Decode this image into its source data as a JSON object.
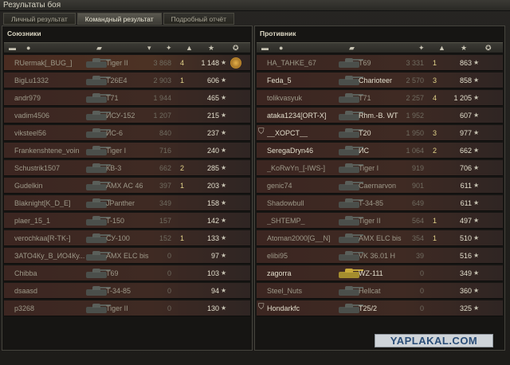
{
  "window": {
    "title": "Результаты боя"
  },
  "tabs": [
    {
      "label": "Личный результат"
    },
    {
      "label": "Командный результат"
    },
    {
      "label": "Подробный отчёт"
    }
  ],
  "allies": {
    "title": "Союзники",
    "rows": [
      {
        "name": "RUermak[_BUG_]",
        "tank": "Tiger II",
        "damage": "3 868",
        "kills": "4",
        "xp": "1 148",
        "alive": false,
        "self": true,
        "medal": true
      },
      {
        "name": "BigLu1332",
        "tank": "T26E4",
        "damage": "2 903",
        "kills": "1",
        "xp": "606",
        "alive": false
      },
      {
        "name": "andr979",
        "tank": "T71",
        "damage": "1 944",
        "kills": "",
        "xp": "465",
        "alive": false
      },
      {
        "name": "vadim4506",
        "tank": "ИСУ-152",
        "damage": "1 207",
        "kills": "",
        "xp": "215",
        "alive": false
      },
      {
        "name": "viksteel56",
        "tank": "ИС-6",
        "damage": "840",
        "kills": "",
        "xp": "237",
        "alive": false
      },
      {
        "name": "Frankenshtene_voin",
        "tank": "Tiger I",
        "damage": "716",
        "kills": "",
        "xp": "240",
        "alive": false
      },
      {
        "name": "Schustrik1507",
        "tank": "КВ-3",
        "damage": "662",
        "kills": "2",
        "xp": "285",
        "alive": false
      },
      {
        "name": "Gudelkin",
        "tank": "AMX AC 46",
        "damage": "397",
        "kills": "1",
        "xp": "203",
        "alive": false
      },
      {
        "name": "Blaknight[K_D_E]",
        "tank": "JPanther",
        "damage": "349",
        "kills": "",
        "xp": "158",
        "alive": false
      },
      {
        "name": "plaer_15_1",
        "tank": "T-150",
        "damage": "157",
        "kills": "",
        "xp": "142",
        "alive": false
      },
      {
        "name": "verochkaa[R-TK-]",
        "tank": "СУ-100",
        "damage": "152",
        "kills": "1",
        "xp": "133",
        "alive": false
      },
      {
        "name": "ЗАТО4Ку_В_ИО4Ку...",
        "tank": "AMX ELC bis",
        "damage": "0",
        "kills": "",
        "xp": "97",
        "alive": false
      },
      {
        "name": "Chibba",
        "tank": "T69",
        "damage": "0",
        "kills": "",
        "xp": "103",
        "alive": false
      },
      {
        "name": "dsaasd",
        "tank": "T-34-85",
        "damage": "0",
        "kills": "",
        "xp": "94",
        "alive": false
      },
      {
        "name": "p3268",
        "tank": "Tiger II",
        "damage": "0",
        "kills": "",
        "xp": "130",
        "alive": false
      }
    ]
  },
  "enemies": {
    "title": "Противник",
    "rows": [
      {
        "name": "HA_TAHKE_67",
        "tank": "T69",
        "damage": "3 331",
        "kills": "1",
        "xp": "863",
        "alive": false
      },
      {
        "name": "Feda_5",
        "tank": "Charioteer",
        "damage": "2 570",
        "kills": "3",
        "xp": "858",
        "alive": true
      },
      {
        "name": "tolikvasyuk",
        "tank": "T71",
        "damage": "2 257",
        "kills": "4",
        "xp": "1 205",
        "alive": false
      },
      {
        "name": "ataka1234[ORT-X]",
        "tank": "Rhm.-B. WT",
        "damage": "1 952",
        "kills": "",
        "xp": "607",
        "alive": true
      },
      {
        "name": "__XOPCT__",
        "tank": "T20",
        "damage": "1 950",
        "kills": "3",
        "xp": "977",
        "alive": true,
        "ribbon": true
      },
      {
        "name": "SeregaDryn46",
        "tank": "ИС",
        "damage": "1 064",
        "kills": "2",
        "xp": "662",
        "alive": true
      },
      {
        "name": "_KoRwYn_[-IWS-]",
        "tank": "Tiger I",
        "damage": "919",
        "kills": "",
        "xp": "706",
        "alive": false
      },
      {
        "name": "genic74",
        "tank": "Caernarvon",
        "damage": "901",
        "kills": "",
        "xp": "611",
        "alive": false
      },
      {
        "name": "Shadowbull",
        "tank": "T-34-85",
        "damage": "649",
        "kills": "",
        "xp": "611",
        "alive": false
      },
      {
        "name": "_SHTEMP_",
        "tank": "Tiger II",
        "damage": "564",
        "kills": "1",
        "xp": "497",
        "alive": false
      },
      {
        "name": "Atoman2000[G__N]",
        "tank": "AMX ELC bis",
        "damage": "354",
        "kills": "1",
        "xp": "510",
        "alive": false
      },
      {
        "name": "elibi95",
        "tank": "VK 36.01 H",
        "damage": "39",
        "kills": "",
        "xp": "516",
        "alive": false
      },
      {
        "name": "zagorra",
        "tank": "WZ-111",
        "damage": "0",
        "kills": "",
        "xp": "349",
        "alive": true,
        "gold": true
      },
      {
        "name": "Steel_Nuts",
        "tank": "Hellcat",
        "damage": "0",
        "kills": "",
        "xp": "360",
        "alive": false
      },
      {
        "name": "Hondarkfc",
        "tank": "T25/2",
        "damage": "0",
        "kills": "",
        "xp": "325",
        "alive": true,
        "ribbon": true
      }
    ]
  },
  "header_icons": [
    "squad-icon",
    "player-icon",
    "tank-icon",
    "damage-icon",
    "frag-icon",
    "xp-star-icon",
    "medal-icon"
  ],
  "star_glyph": "★",
  "watermark": "YAPLAKAL.COM"
}
